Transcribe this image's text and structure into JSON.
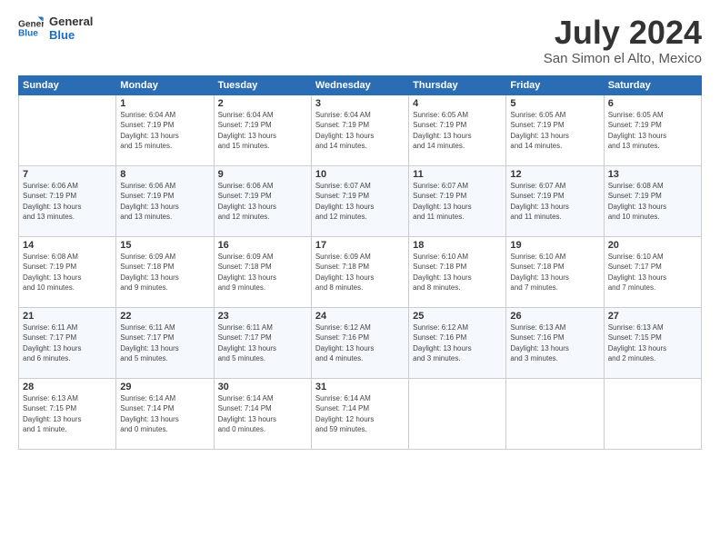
{
  "logo": {
    "line1": "General",
    "line2": "Blue"
  },
  "title": "July 2024",
  "subtitle": "San Simon el Alto, Mexico",
  "days_header": [
    "Sunday",
    "Monday",
    "Tuesday",
    "Wednesday",
    "Thursday",
    "Friday",
    "Saturday"
  ],
  "weeks": [
    [
      {
        "day": "",
        "info": ""
      },
      {
        "day": "1",
        "info": "Sunrise: 6:04 AM\nSunset: 7:19 PM\nDaylight: 13 hours\nand 15 minutes."
      },
      {
        "day": "2",
        "info": "Sunrise: 6:04 AM\nSunset: 7:19 PM\nDaylight: 13 hours\nand 15 minutes."
      },
      {
        "day": "3",
        "info": "Sunrise: 6:04 AM\nSunset: 7:19 PM\nDaylight: 13 hours\nand 14 minutes."
      },
      {
        "day": "4",
        "info": "Sunrise: 6:05 AM\nSunset: 7:19 PM\nDaylight: 13 hours\nand 14 minutes."
      },
      {
        "day": "5",
        "info": "Sunrise: 6:05 AM\nSunset: 7:19 PM\nDaylight: 13 hours\nand 14 minutes."
      },
      {
        "day": "6",
        "info": "Sunrise: 6:05 AM\nSunset: 7:19 PM\nDaylight: 13 hours\nand 13 minutes."
      }
    ],
    [
      {
        "day": "7",
        "info": "Sunrise: 6:06 AM\nSunset: 7:19 PM\nDaylight: 13 hours\nand 13 minutes."
      },
      {
        "day": "8",
        "info": "Sunrise: 6:06 AM\nSunset: 7:19 PM\nDaylight: 13 hours\nand 13 minutes."
      },
      {
        "day": "9",
        "info": "Sunrise: 6:06 AM\nSunset: 7:19 PM\nDaylight: 13 hours\nand 12 minutes."
      },
      {
        "day": "10",
        "info": "Sunrise: 6:07 AM\nSunset: 7:19 PM\nDaylight: 13 hours\nand 12 minutes."
      },
      {
        "day": "11",
        "info": "Sunrise: 6:07 AM\nSunset: 7:19 PM\nDaylight: 13 hours\nand 11 minutes."
      },
      {
        "day": "12",
        "info": "Sunrise: 6:07 AM\nSunset: 7:19 PM\nDaylight: 13 hours\nand 11 minutes."
      },
      {
        "day": "13",
        "info": "Sunrise: 6:08 AM\nSunset: 7:19 PM\nDaylight: 13 hours\nand 10 minutes."
      }
    ],
    [
      {
        "day": "14",
        "info": "Sunrise: 6:08 AM\nSunset: 7:19 PM\nDaylight: 13 hours\nand 10 minutes."
      },
      {
        "day": "15",
        "info": "Sunrise: 6:09 AM\nSunset: 7:18 PM\nDaylight: 13 hours\nand 9 minutes."
      },
      {
        "day": "16",
        "info": "Sunrise: 6:09 AM\nSunset: 7:18 PM\nDaylight: 13 hours\nand 9 minutes."
      },
      {
        "day": "17",
        "info": "Sunrise: 6:09 AM\nSunset: 7:18 PM\nDaylight: 13 hours\nand 8 minutes."
      },
      {
        "day": "18",
        "info": "Sunrise: 6:10 AM\nSunset: 7:18 PM\nDaylight: 13 hours\nand 8 minutes."
      },
      {
        "day": "19",
        "info": "Sunrise: 6:10 AM\nSunset: 7:18 PM\nDaylight: 13 hours\nand 7 minutes."
      },
      {
        "day": "20",
        "info": "Sunrise: 6:10 AM\nSunset: 7:17 PM\nDaylight: 13 hours\nand 7 minutes."
      }
    ],
    [
      {
        "day": "21",
        "info": "Sunrise: 6:11 AM\nSunset: 7:17 PM\nDaylight: 13 hours\nand 6 minutes."
      },
      {
        "day": "22",
        "info": "Sunrise: 6:11 AM\nSunset: 7:17 PM\nDaylight: 13 hours\nand 5 minutes."
      },
      {
        "day": "23",
        "info": "Sunrise: 6:11 AM\nSunset: 7:17 PM\nDaylight: 13 hours\nand 5 minutes."
      },
      {
        "day": "24",
        "info": "Sunrise: 6:12 AM\nSunset: 7:16 PM\nDaylight: 13 hours\nand 4 minutes."
      },
      {
        "day": "25",
        "info": "Sunrise: 6:12 AM\nSunset: 7:16 PM\nDaylight: 13 hours\nand 3 minutes."
      },
      {
        "day": "26",
        "info": "Sunrise: 6:13 AM\nSunset: 7:16 PM\nDaylight: 13 hours\nand 3 minutes."
      },
      {
        "day": "27",
        "info": "Sunrise: 6:13 AM\nSunset: 7:15 PM\nDaylight: 13 hours\nand 2 minutes."
      }
    ],
    [
      {
        "day": "28",
        "info": "Sunrise: 6:13 AM\nSunset: 7:15 PM\nDaylight: 13 hours\nand 1 minute."
      },
      {
        "day": "29",
        "info": "Sunrise: 6:14 AM\nSunset: 7:14 PM\nDaylight: 13 hours\nand 0 minutes."
      },
      {
        "day": "30",
        "info": "Sunrise: 6:14 AM\nSunset: 7:14 PM\nDaylight: 13 hours\nand 0 minutes."
      },
      {
        "day": "31",
        "info": "Sunrise: 6:14 AM\nSunset: 7:14 PM\nDaylight: 12 hours\nand 59 minutes."
      },
      {
        "day": "",
        "info": ""
      },
      {
        "day": "",
        "info": ""
      },
      {
        "day": "",
        "info": ""
      }
    ]
  ]
}
